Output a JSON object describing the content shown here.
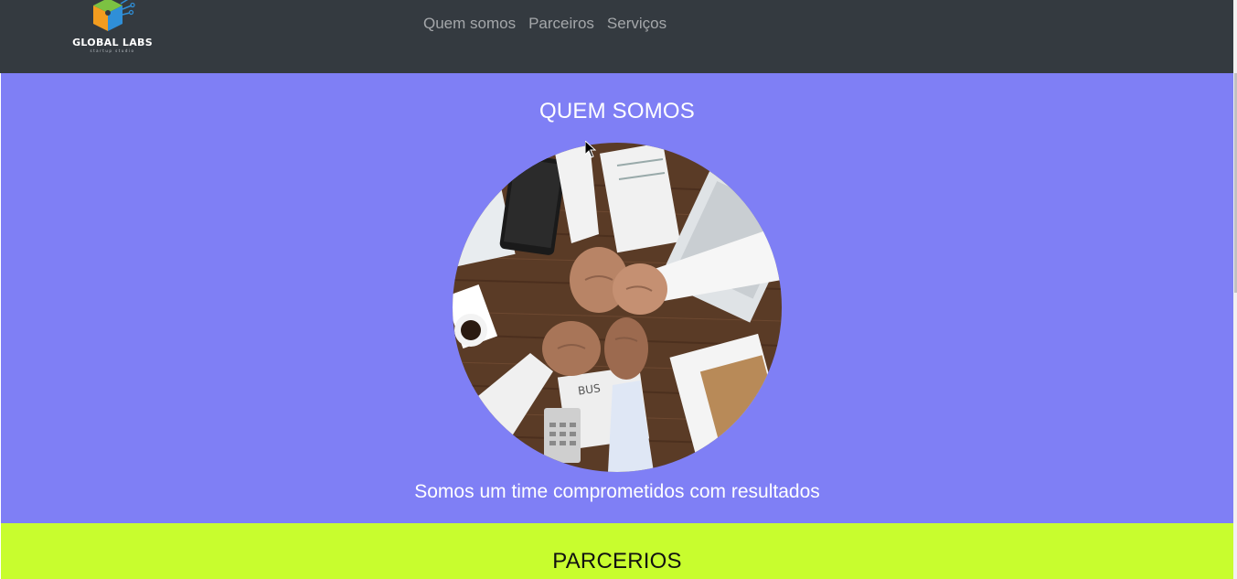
{
  "navbar": {
    "brand_name": "GLOBAL LABS",
    "brand_tagline": "startup studio",
    "links": [
      {
        "label": "Quem somos"
      },
      {
        "label": "Parceiros"
      },
      {
        "label": "Serviços"
      }
    ],
    "background": "#343a40"
  },
  "quem_somos": {
    "title": "QUEM SOMOS",
    "text": "Somos um time comprometidos com resultados",
    "background": "#7f7ff5",
    "image_icon": "teamwork-fist-bump-photo"
  },
  "parceiros": {
    "title": "PARCERIOS",
    "background": "#c8fd2e"
  }
}
